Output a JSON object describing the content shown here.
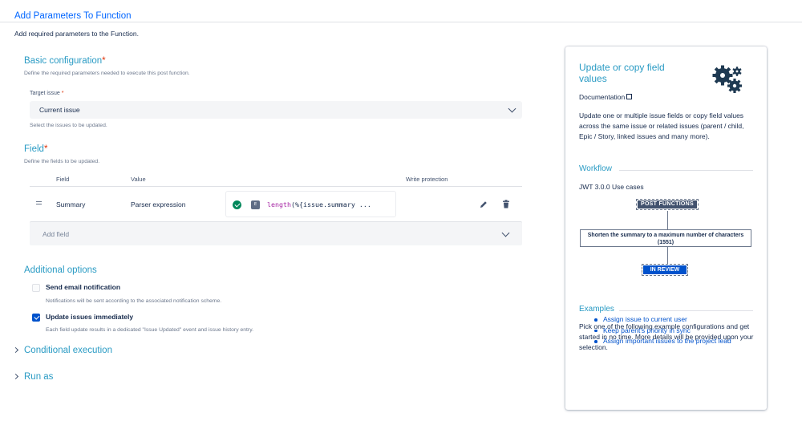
{
  "header": {
    "title": "Add Parameters To Function",
    "subtitle": "Add required parameters to the Function."
  },
  "basic": {
    "title": "Basic configuration",
    "required_mark": "*",
    "description": "Define the required parameters needed to execute this post function.",
    "target_label": "Target issue",
    "target_required": "*",
    "target_value": "Current issue",
    "target_help": "Select the issues to be updated."
  },
  "field": {
    "title": "Field",
    "required_mark": "*",
    "description": "Define the fields to be updated.",
    "columns": [
      "Field",
      "Value",
      "Write protection"
    ],
    "rows": [
      {
        "field": "Summary",
        "value_type": "Parser expression",
        "expression_badge": "E",
        "expression_fn": "length",
        "expression_rest": "(%{issue.summary ..."
      }
    ],
    "add_placeholder": "Add field"
  },
  "additional": {
    "title": "Additional options",
    "options": [
      {
        "label": "Send email notification",
        "checked": false,
        "description": "Notifications will be sent according to the associated notification scheme."
      },
      {
        "label": "Update issues immediately",
        "checked": true,
        "description": "Each field update results in a dedicated \"Issue Updated\" event and issue history entry."
      }
    ]
  },
  "collapsibles": {
    "conditional": "Conditional execution",
    "run_as": "Run as"
  },
  "panel": {
    "title": "Update or copy field values",
    "doc_link": "Documentation",
    "description": "Update one or multiple issue fields or copy field values across the same issue or related issues (parent / child, Epic / Story, linked issues and many more).",
    "workflow_title": "Workflow",
    "workflow_caption": "JWT 3.0.0 Use cases",
    "wf_post": "POST FUNCTIONS",
    "wf_func": "Shorten the summary to a maximum number of characters (1551)",
    "wf_review": "IN REVIEW",
    "examples_title": "Examples",
    "examples_text": "Pick one of the following example configurations and get started in no time. More details will be provided upon your selection.",
    "examples": [
      "Assign issue to current user",
      "Keep parent's priority in sync",
      "Assign important issues to the project lead"
    ]
  },
  "colors": {
    "accent": "#2a9bc4",
    "link": "#0052cc",
    "required": "#de350b",
    "success": "#00875a"
  },
  "icons": [
    "drag-handle-icon",
    "check-circle-icon",
    "expression-icon",
    "pencil-icon",
    "trash-icon",
    "chevron-down-icon",
    "chevron-right-icon",
    "gears-icon",
    "external-link-icon"
  ]
}
